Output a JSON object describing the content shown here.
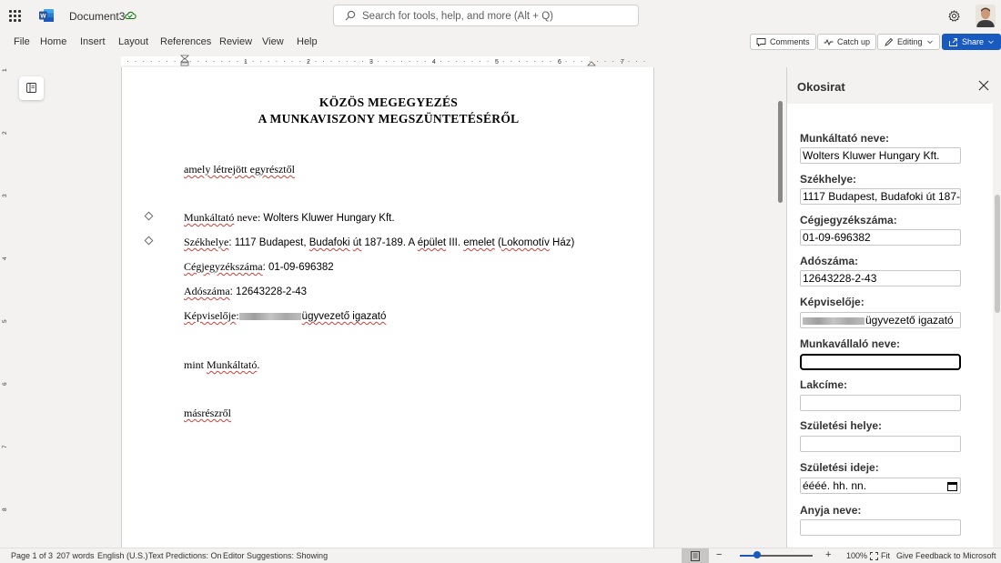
{
  "titlebar": {
    "doc_title": "Document3",
    "search_placeholder": "Search for tools, help, and more (Alt + Q)"
  },
  "ribbon": {
    "tabs": [
      "File",
      "Home",
      "Insert",
      "Layout",
      "References",
      "Review",
      "View",
      "Help"
    ],
    "comments_label": "Comments",
    "catchup_label": "Catch up",
    "editing_label": "Editing",
    "share_label": "Share"
  },
  "ruler": {
    "numbers": [
      "1",
      "2",
      "3",
      "4",
      "5",
      "6",
      "7"
    ],
    "vnumbers": [
      "1",
      "2",
      "3",
      "4",
      "5",
      "6",
      "7",
      "8"
    ]
  },
  "document": {
    "heading_1": "KÖZÖS MEGEGYEZÉS",
    "heading_2": "A MUNKAVISZONY MEGSZÜNTETÉSÉRŐL",
    "intro": "amely létrejött egyrésztől",
    "employer_label": "Munkáltató",
    "employer_label_rest": " neve: ",
    "employer_value": "Wolters Kluwer Hungary Kft.",
    "seat_label": "Székhelye",
    "seat_value_1": ": 1117 Budapest, ",
    "seat_value_budafoki": "Budafoki",
    "seat_value_ut": "út",
    "seat_value_2": " 187-189. A ",
    "seat_value_epulet": "épület",
    "seat_value_3": " III. ",
    "seat_value_emelet": "emelet",
    "seat_value_4": " (",
    "seat_value_lokomotiv": "Lokomotív",
    "seat_value_5": " Ház)",
    "regno_label": "Cégjegyzékszáma",
    "regno_value": ": 01-09-696382",
    "tax_label": "Adószáma",
    "tax_value": ": 12643228-2-43",
    "rep_label": "Képviselője",
    "rep_colon": ":",
    "rep_value": "ügyvezető igazató",
    "as_employer_1": "mint ",
    "as_employer_2": "Munkáltató",
    "as_employer_3": ".",
    "other_side": "másrészről"
  },
  "pane": {
    "title": "Okosirat",
    "fields": [
      {
        "label": "Munkáltató neve:",
        "value": "Wolters Kluwer Hungary Kft."
      },
      {
        "label": "Székhelye:",
        "value": "1117 Budapest, Budafoki út 187-1"
      },
      {
        "label": "Cégjegyzékszáma:",
        "value": "01-09-696382"
      },
      {
        "label": "Adószáma:",
        "value": "12643228-2-43"
      },
      {
        "label": "Képviselője:",
        "value": "ügyvezető igazató"
      },
      {
        "label": "Munkavállaló neve:",
        "value": ""
      },
      {
        "label": "Lakcíme:",
        "value": ""
      },
      {
        "label": "Születési helye:",
        "value": ""
      },
      {
        "label": "Születési ideje:",
        "value": "éééé. hh. nn."
      },
      {
        "label": "Anyja neve:",
        "value": ""
      }
    ]
  },
  "statusbar": {
    "page": "Page 1 of 3",
    "words": "207 words",
    "language": "English (U.S.)",
    "predictions": "Text Predictions: On",
    "editor": "Editor Suggestions: Showing",
    "zoom_minus": "−",
    "zoom_plus": "+",
    "zoom_level": "100%",
    "zoom_fraction": 0.24,
    "fit": "Fit",
    "feedback": "Give Feedback to Microsoft"
  },
  "colors": {
    "accent": "#185abd",
    "word_blue": "#2b579a",
    "squiggle": "#c8413a",
    "sync_green": "#107c10"
  }
}
